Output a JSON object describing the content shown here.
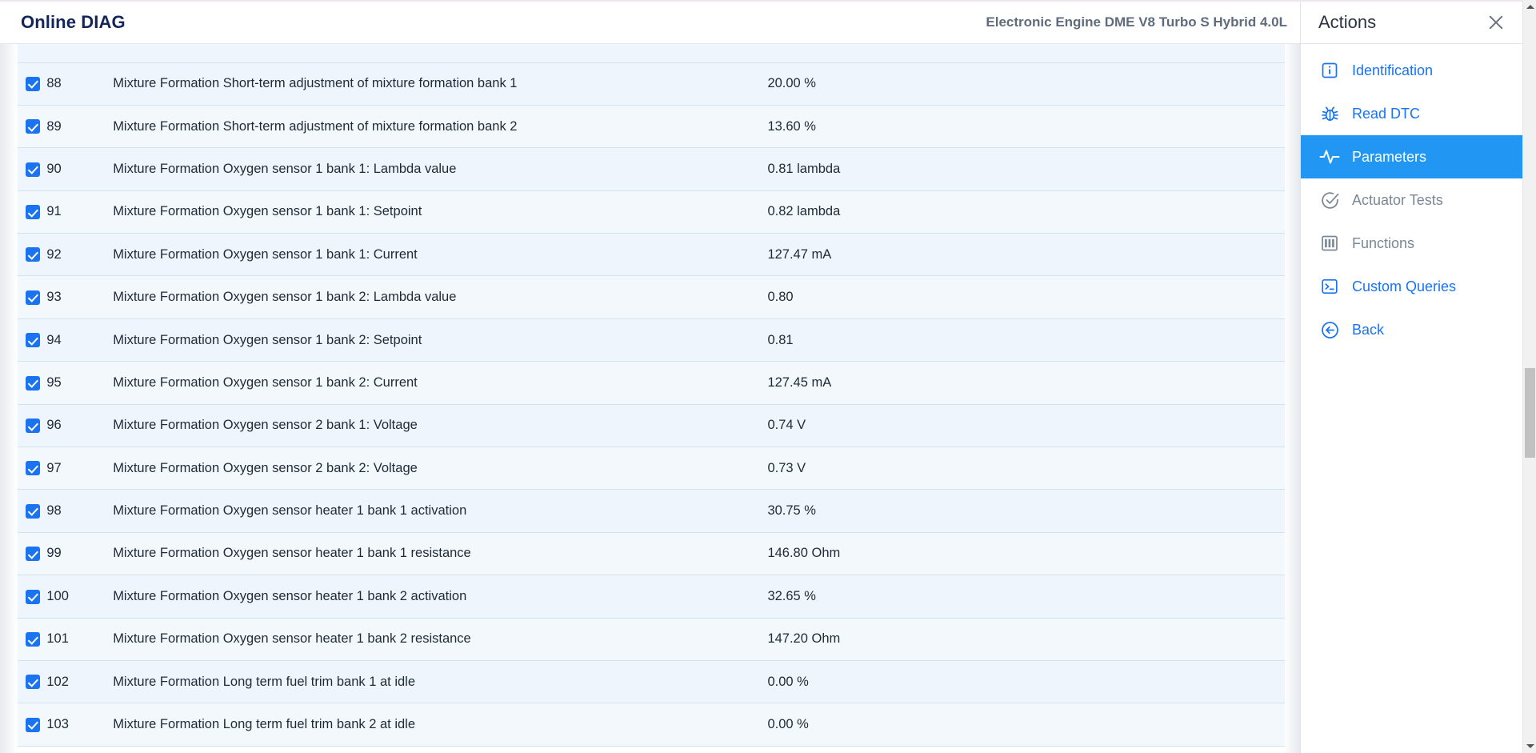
{
  "header": {
    "app_title": "Online DIAG",
    "ecu_title": "Electronic Engine DME V8 Turbo S Hybrid 4.0L"
  },
  "table": {
    "columns": [
      "select",
      "id",
      "name",
      "value"
    ],
    "rows": [
      {
        "id": "88",
        "name": "Mixture Formation Short-term adjustment of mixture formation bank 1",
        "value": "20.00 %",
        "checked": true
      },
      {
        "id": "89",
        "name": "Mixture Formation Short-term adjustment of mixture formation bank 2",
        "value": "13.60 %",
        "checked": true
      },
      {
        "id": "90",
        "name": "Mixture Formation Oxygen sensor 1 bank 1: Lambda value",
        "value": "0.81 lambda",
        "checked": true
      },
      {
        "id": "91",
        "name": "Mixture Formation Oxygen sensor 1 bank 1: Setpoint",
        "value": "0.82 lambda",
        "checked": true
      },
      {
        "id": "92",
        "name": "Mixture Formation Oxygen sensor 1 bank 1: Current",
        "value": "127.47 mA",
        "checked": true
      },
      {
        "id": "93",
        "name": "Mixture Formation Oxygen sensor 1 bank 2: Lambda value",
        "value": "0.80",
        "checked": true
      },
      {
        "id": "94",
        "name": "Mixture Formation Oxygen sensor 1 bank 2: Setpoint",
        "value": "0.81",
        "checked": true
      },
      {
        "id": "95",
        "name": "Mixture Formation Oxygen sensor 1 bank 2: Current",
        "value": "127.45 mA",
        "checked": true
      },
      {
        "id": "96",
        "name": "Mixture Formation Oxygen sensor 2 bank 1: Voltage",
        "value": "0.74 V",
        "checked": true
      },
      {
        "id": "97",
        "name": "Mixture Formation Oxygen sensor 2 bank 2: Voltage",
        "value": "0.73 V",
        "checked": true
      },
      {
        "id": "98",
        "name": "Mixture Formation Oxygen sensor heater 1 bank 1 activation",
        "value": "30.75 %",
        "checked": true
      },
      {
        "id": "99",
        "name": "Mixture Formation Oxygen sensor heater 1 bank 1 resistance",
        "value": "146.80 Ohm",
        "checked": true
      },
      {
        "id": "100",
        "name": "Mixture Formation Oxygen sensor heater 1 bank 2 activation",
        "value": "32.65 %",
        "checked": true
      },
      {
        "id": "101",
        "name": "Mixture Formation Oxygen sensor heater 1 bank 2 resistance",
        "value": "147.20 Ohm",
        "checked": true
      },
      {
        "id": "102",
        "name": "Mixture Formation Long term fuel trim bank 1 at idle",
        "value": "0.00 %",
        "checked": true
      },
      {
        "id": "103",
        "name": "Mixture Formation Long term fuel trim bank 2 at idle",
        "value": "0.00 %",
        "checked": true
      }
    ]
  },
  "actions": {
    "title": "Actions",
    "close_icon": "close-icon",
    "items": [
      {
        "label": "Identification",
        "icon": "info-box-icon",
        "state": "enabled"
      },
      {
        "label": "Read DTC",
        "icon": "bug-icon",
        "state": "enabled"
      },
      {
        "label": "Parameters",
        "icon": "activity-pulse-icon",
        "state": "active"
      },
      {
        "label": "Actuator Tests",
        "icon": "circle-check-icon",
        "state": "disabled"
      },
      {
        "label": "Functions",
        "icon": "panels-icon",
        "state": "disabled"
      },
      {
        "label": "Custom Queries",
        "icon": "terminal-icon",
        "state": "enabled"
      },
      {
        "label": "Back",
        "icon": "circle-arrow-left-icon",
        "state": "enabled"
      }
    ]
  },
  "colors": {
    "accent_blue": "#1a73f0",
    "active_blue": "#2196f3",
    "title_navy": "#12265c",
    "ecu_gray": "#5f6c7b",
    "row_bg": "#eef5fc",
    "row_border": "#d3e3ee",
    "disabled_gray": "#7b8795",
    "scrollbar_thumb": "#c1c1c1"
  }
}
